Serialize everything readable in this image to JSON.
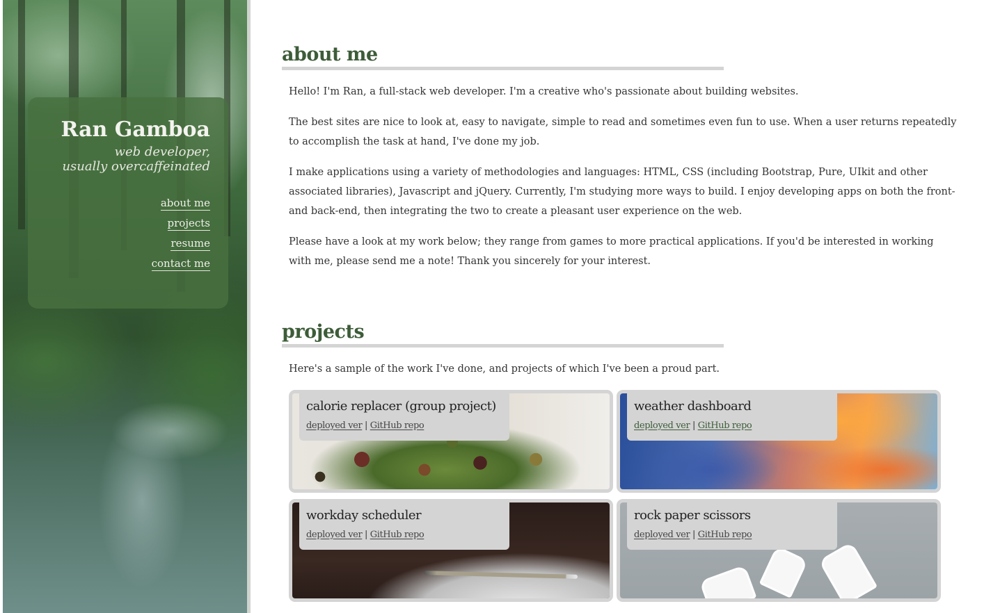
{
  "sidebar": {
    "name": "Ran Gamboa",
    "tagline_line1": "web developer,",
    "tagline_line2": "usually overcaffeinated",
    "nav": [
      {
        "label": "about me"
      },
      {
        "label": "projects"
      },
      {
        "label": "resume"
      },
      {
        "label": "contact me"
      }
    ]
  },
  "about": {
    "heading": "about me",
    "paragraphs": [
      "Hello! I'm Ran, a full-stack web developer. I'm a creative who's passionate about building websites.",
      "The best sites are nice to look at, easy to navigate, simple to read and sometimes even fun to use. When a user returns repeatedly to accomplish the task at hand, I've done my job.",
      "I make applications using a variety of methodologies and languages: HTML, CSS (including Bootstrap, Pure, UIkit and other associated libraries), Javascript and jQuery. Currently, I'm studying more ways to build. I enjoy developing apps on both the front- and back-end, then integrating the two to create a pleasant user experience on the web.",
      "Please have a look at my work below; they range from games to more practical applications. If you'd be interested in working with me, please send me a note! Thank you sincerely for your interest."
    ]
  },
  "projects": {
    "heading": "projects",
    "intro": "Here's a sample of the work I've done, and projects of which I've been a proud part.",
    "separator": "|",
    "items": [
      {
        "title": "calorie replacer (group project)",
        "deployed_label": "deployed ver",
        "repo_label": "GitHub repo"
      },
      {
        "title": "weather dashboard",
        "deployed_label": "deployed ver",
        "repo_label": "GitHub repo"
      },
      {
        "title": "workday scheduler",
        "deployed_label": "deployed ver",
        "repo_label": "GitHub repo"
      },
      {
        "title": "rock paper scissors",
        "deployed_label": "deployed ver",
        "repo_label": "GitHub repo"
      }
    ]
  }
}
